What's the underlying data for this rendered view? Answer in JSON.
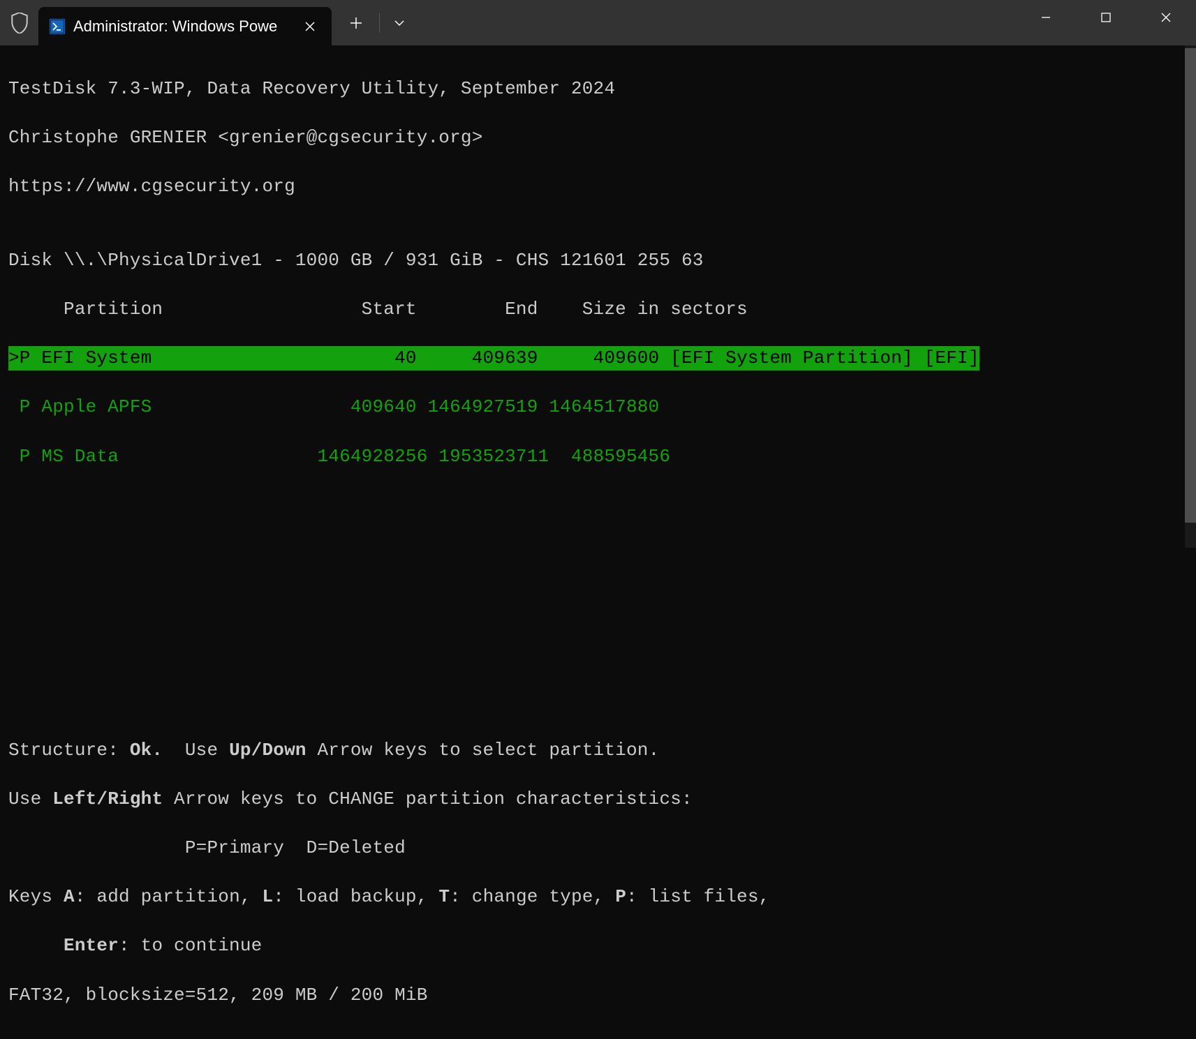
{
  "window": {
    "tab_title": "Administrator: Windows Powe"
  },
  "terminal": {
    "line1": "TestDisk 7.3-WIP, Data Recovery Utility, September 2024",
    "line2": "Christophe GRENIER <grenier@cgsecurity.org>",
    "line3": "https://www.cgsecurity.org",
    "blank1": "",
    "disk_line": "Disk \\\\.\\PhysicalDrive1 - 1000 GB / 931 GiB - CHS 121601 255 63",
    "header": "     Partition                  Start        End    Size in sectors",
    "partitions": [
      {
        "selected": true,
        "text": ">P EFI System                      40     409639     409600 [EFI System Partition] [EFI]"
      },
      {
        "selected": false,
        "text": " P Apple APFS                  409640 1464927519 1464517880"
      },
      {
        "selected": false,
        "text": " P MS Data                  1464928256 1953523711  488595456"
      }
    ],
    "help": {
      "structure_prefix": "Structure: ",
      "structure_status": "Ok.",
      "structure_suffix": "  Use ",
      "updown_bold": "Up/Down",
      "updown_suffix": " Arrow keys to select partition.",
      "lr_prefix": "Use ",
      "lr_bold": "Left/Right",
      "lr_suffix": " Arrow keys to CHANGE partition characteristics:",
      "pd_line": "                P=Primary  D=Deleted",
      "keys_prefix": "Keys ",
      "keys_a": "A",
      "keys_a_suffix": ": add partition, ",
      "keys_l": "L",
      "keys_l_suffix": ": load backup, ",
      "keys_t": "T",
      "keys_t_suffix": ": change type, ",
      "keys_p": "P",
      "keys_p_suffix": ": list files,",
      "enter_prefix": "     ",
      "enter_bold": "Enter",
      "enter_suffix": ": to continue",
      "fs_line": "FAT32, blocksize=512, 209 MB / 200 MiB"
    }
  }
}
